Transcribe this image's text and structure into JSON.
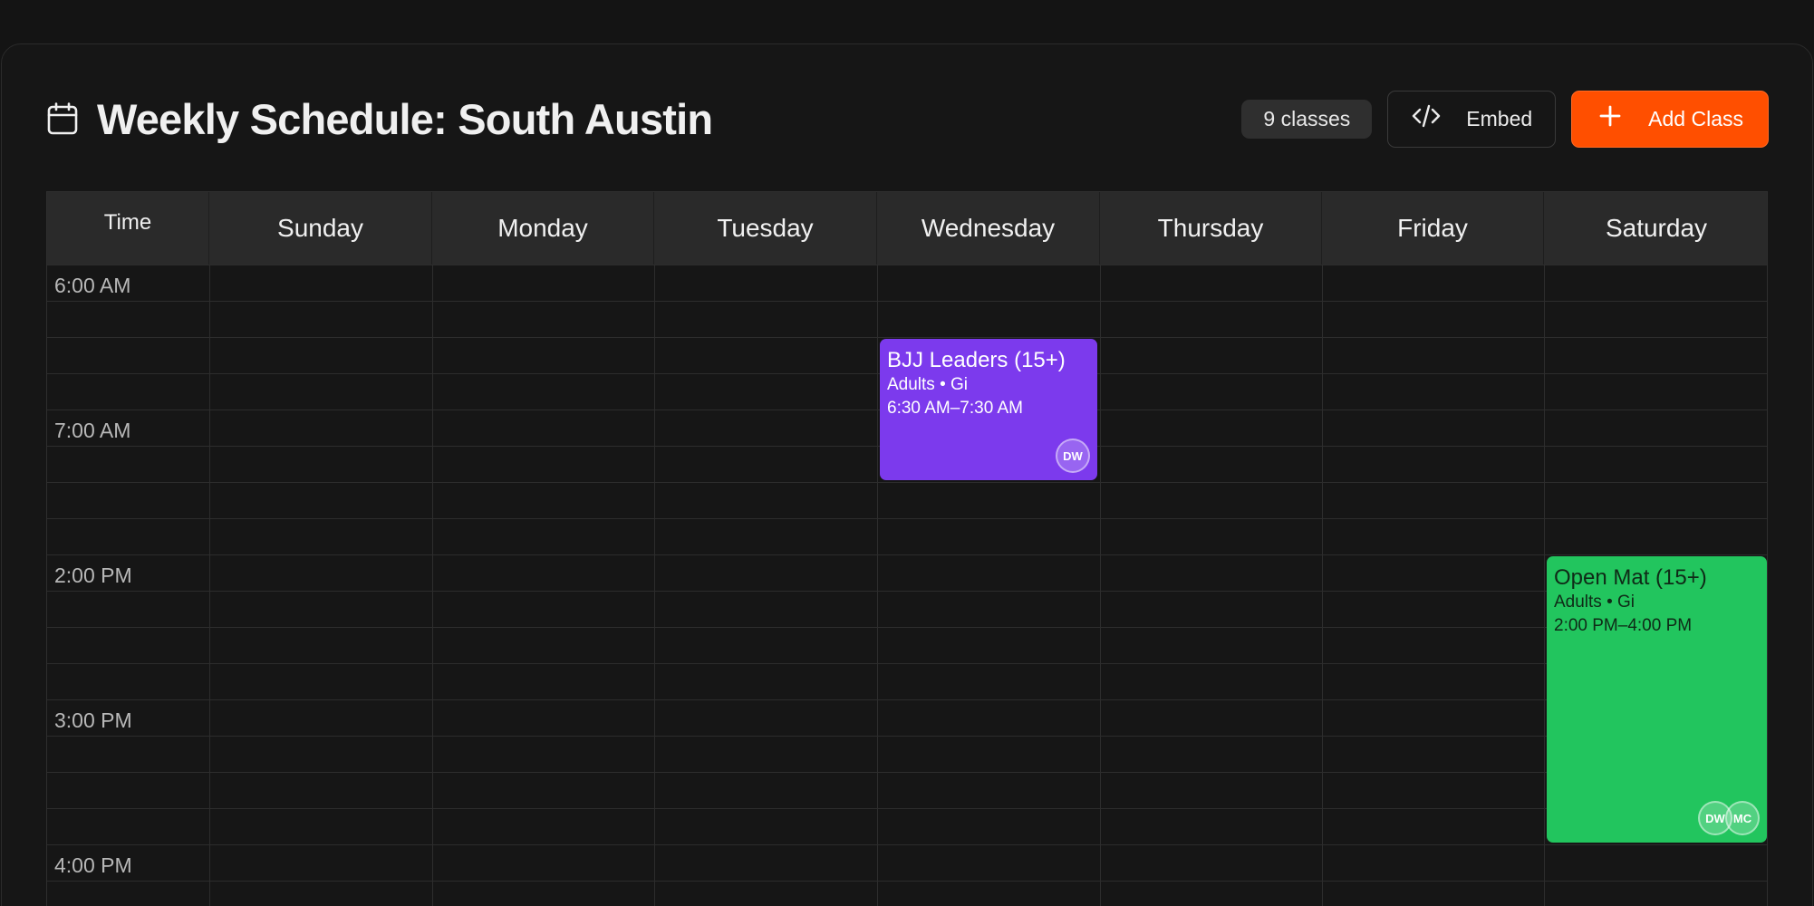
{
  "header": {
    "title": "Weekly Schedule: South Austin",
    "class_count": "9 classes",
    "embed_label": "Embed",
    "add_label": "Add Class",
    "icons": {
      "title": "calendar-icon",
      "embed": "code-icon",
      "add": "plus-icon"
    }
  },
  "grid": {
    "time_header": "Time",
    "days": [
      "Sunday",
      "Monday",
      "Tuesday",
      "Wednesday",
      "Thursday",
      "Friday",
      "Saturday"
    ],
    "time_labels": [
      "6:00 AM",
      "7:00 AM",
      "2:00 PM",
      "3:00 PM",
      "4:00 PM"
    ]
  },
  "events": [
    {
      "title": "BJJ Leaders (15+)",
      "meta": "Adults • Gi",
      "time": "6:30 AM–7:30 AM",
      "avatars": [
        "DW"
      ],
      "color": "#7c3aed",
      "text_color": "#ffffff"
    },
    {
      "title": "Open Mat (15+)",
      "meta": "Adults • Gi",
      "time": "2:00 PM–4:00 PM",
      "avatars": [
        "DW",
        "MC"
      ],
      "color": "#22c55e",
      "text_color": "#0f2a17"
    }
  ],
  "colors": {
    "accent": "#ff4f00",
    "background": "#141414"
  }
}
